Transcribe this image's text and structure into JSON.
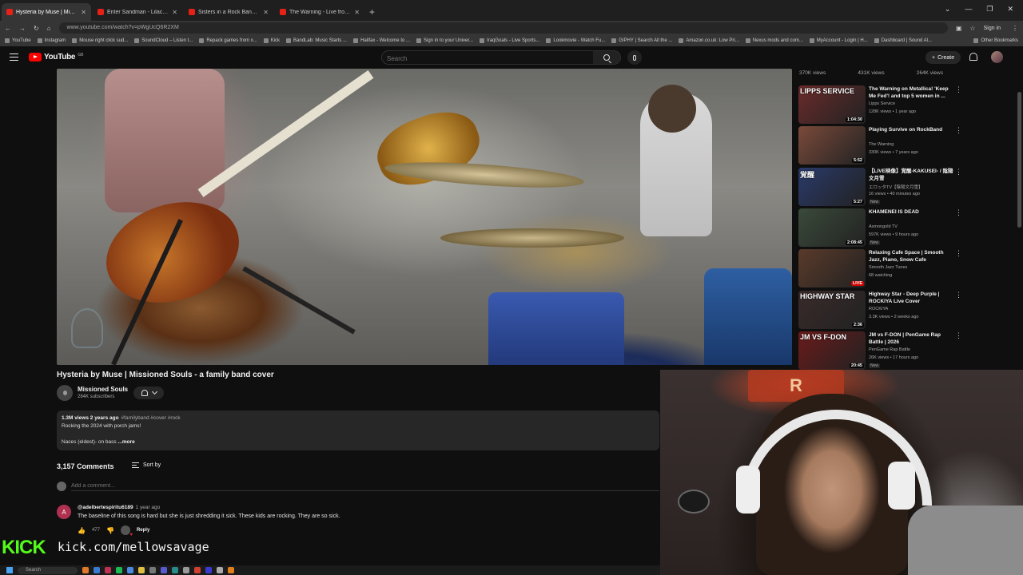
{
  "browser": {
    "tabs": [
      {
        "label": "Hysteria by Muse | Missioned S",
        "active": true
      },
      {
        "label": "Enter Sandman - Lilac (Official",
        "active": false
      },
      {
        "label": "Sisters in a Rock Band Play Trul",
        "active": false
      },
      {
        "label": "The Warning - Live from Pepsi C",
        "active": false
      }
    ],
    "url": "www.youtube.com/watch?v=pWgUcQ6R2XM",
    "signin_label": "Sign in",
    "bookmarks": [
      "YouTube",
      "Instagram",
      "Mouse right click sud...",
      "SoundCloud – Listen t...",
      "Repack games from x...",
      "Kick",
      "BandLab: Music Starts ...",
      "Halifax - Welcome to ...",
      "Sign in to your Univer...",
      "IraqGoals - Live Sports...",
      "Lookmovie - Watch Fu...",
      "GIPHY | Search All the ...",
      "Amazon.co.uk: Low Pri...",
      "Nexus mods and com...",
      "MyAccount - Login | H...",
      "Dashboard | Sound Al..."
    ],
    "other_bookmarks": "Other Bookmarks"
  },
  "header": {
    "logo_text": "YouTube",
    "logo_country": "GB",
    "search_placeholder": "Search",
    "create_label": "Create"
  },
  "video": {
    "title": "Hysteria by Muse | Missioned Souls - a family band cover",
    "channel_name": "Missioned Souls",
    "channel_subs": "284K subscribers",
    "description": {
      "meta": "1.3M views  2 years ago",
      "tags": "#familyband #cover #rock",
      "line1": "Rocking the 2024 with porch jams!",
      "line2": "Naces (eldest)- on bass",
      "more": "...more"
    }
  },
  "comments": {
    "count": "3,157 Comments",
    "sort_label": "Sort by",
    "add_placeholder": "Add a comment...",
    "items": [
      {
        "avatar_letter": "A",
        "author": "@adelbertespiritu6189",
        "time": "1 year ago",
        "text": "The baseline of this song is hard but she is just shredding it sick. These kids are rocking. They are so sick.",
        "likes": "477",
        "reply_label": "Reply"
      }
    ]
  },
  "sidebar": {
    "top_views": [
      "370K views",
      "431K views",
      "264K views"
    ],
    "items": [
      {
        "title": "The Warning on Metallica! 'Keep Me Fed'! and top 5 women in ...",
        "channel": "Lipps Service",
        "meta": "128K views • 1 year ago",
        "duration": "1:04:30",
        "thumb_text": "LIPPS SERVICE",
        "thumb_color": "#6a2b2b",
        "badge": ""
      },
      {
        "title": "Playing Survive on RockBand",
        "channel": "The Warning",
        "meta": "330K views • 7 years ago",
        "duration": "5:52",
        "thumb_text": "",
        "thumb_color": "#7a4a3a",
        "badge": ""
      },
      {
        "title": "【LIVE映像】覚醒-KAKUSEI- / 陰陽文月雪",
        "channel": "エロッタTV【陰陽文月雪】",
        "meta": "16 views • 40 minutes ago",
        "duration": "5:27",
        "thumb_text": "覚醒",
        "thumb_color": "#2a3a6a",
        "badge": "New"
      },
      {
        "title": "KHAMENEI IS DEAD",
        "channel": "Asmongold TV",
        "meta": "597K views • 9 hours ago",
        "duration": "2:08:45",
        "thumb_text": "",
        "thumb_color": "#3a4a3a",
        "badge": "New"
      },
      {
        "title": "Relaxing Cafe Space | Smooth Jazz, Piano, Snow Cafe",
        "channel": "Smooth Jazz Tunes",
        "meta": "68 watching",
        "duration": "LIVE",
        "thumb_text": "",
        "thumb_color": "#5a3a2a",
        "badge": ""
      },
      {
        "title": "Highway Star - Deep Purple | ROCKIYA Live Cover",
        "channel": "ROCKIYA",
        "meta": "3.3K views • 2 weeks ago",
        "duration": "2:36",
        "thumb_text": "HIGHWAY STAR",
        "thumb_color": "#3a2a2a",
        "badge": ""
      },
      {
        "title": "JM vs F-DON | PenGame Rap Battle | 2026",
        "channel": "PenGame Rap Battle",
        "meta": "26K views • 17 hours ago",
        "duration": "20:45",
        "thumb_text": "JM VS F-DON",
        "thumb_color": "#6a1a1a",
        "badge": "New"
      }
    ]
  },
  "overlay": {
    "kick_logo": "KICK",
    "kick_url": "kick.com/mellowsavage",
    "webcam_sign": "R"
  },
  "taskbar": {
    "search_label": "Search"
  }
}
